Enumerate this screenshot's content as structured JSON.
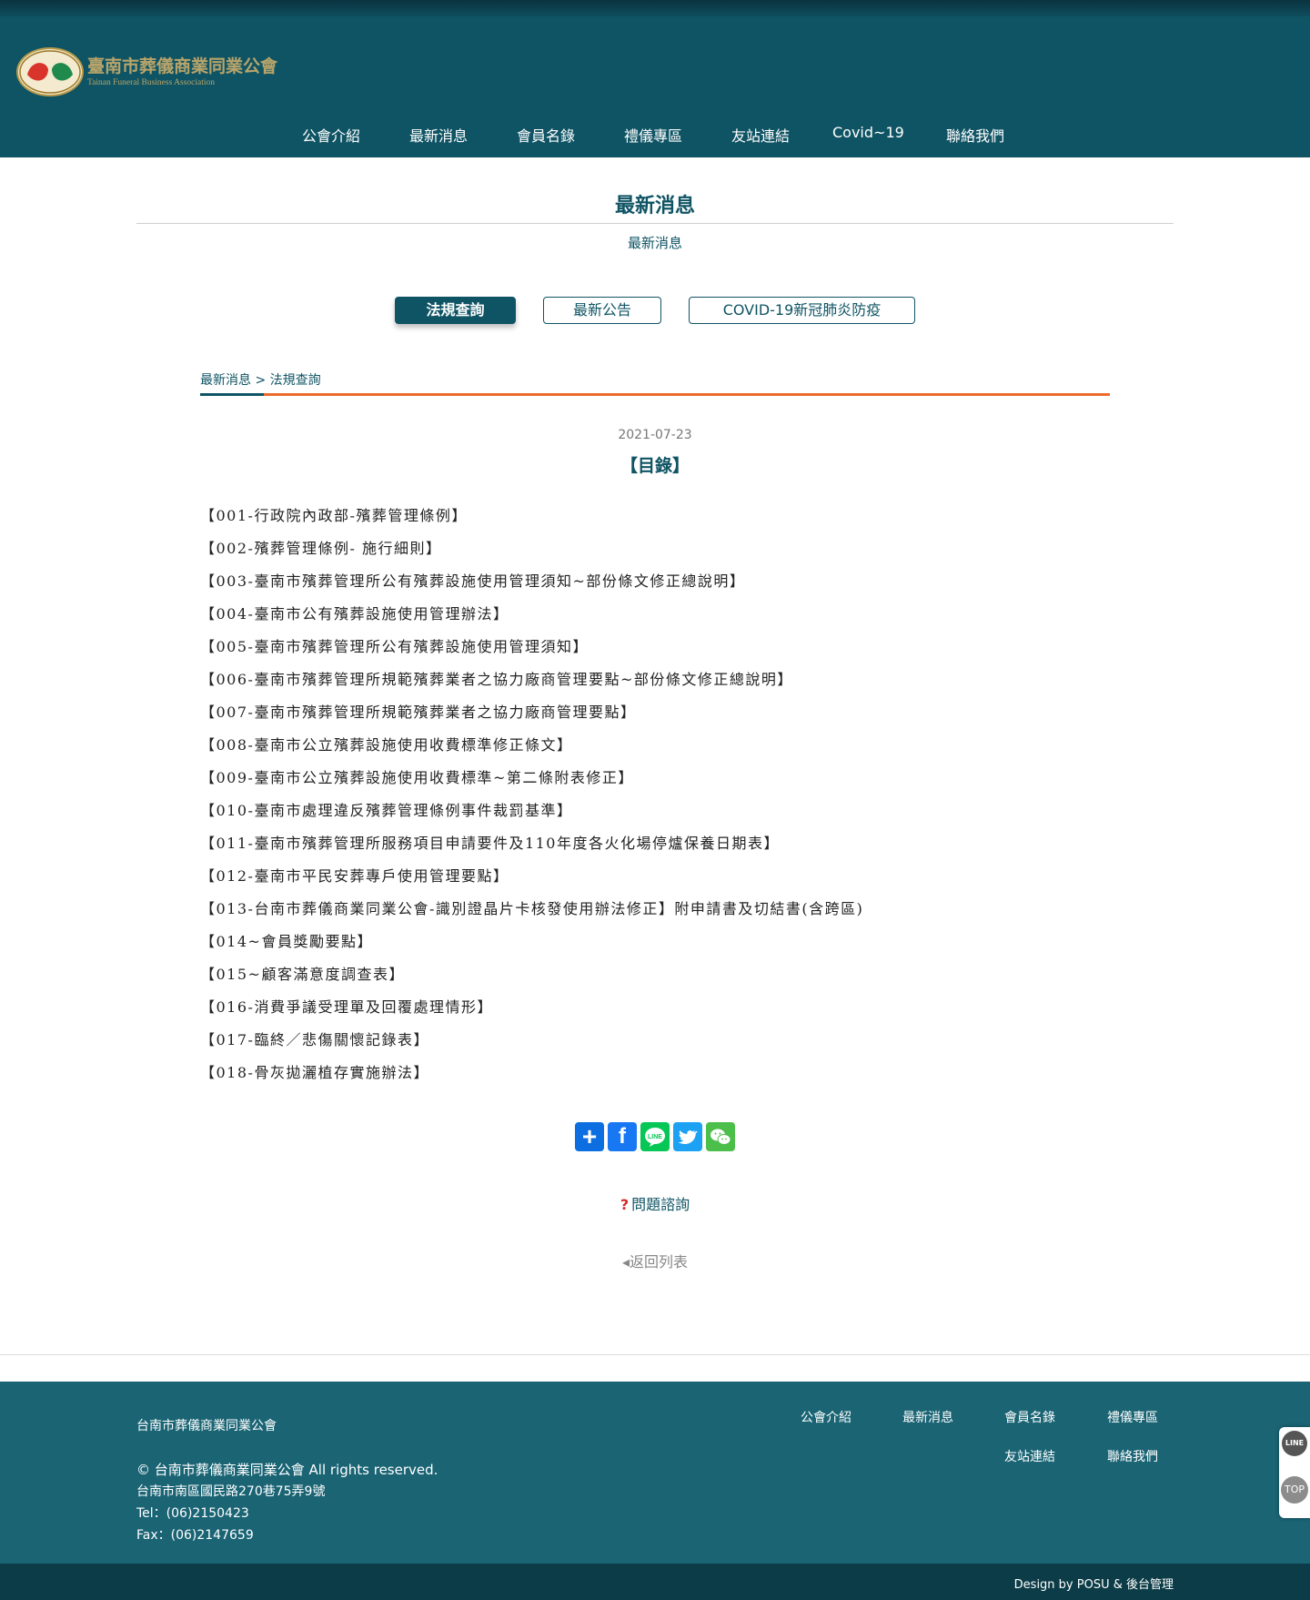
{
  "site": {
    "logo_name": "臺南市葬儀商業同業公會",
    "logo_english": "Tainan Funeral Business Association",
    "logo_seal_text": "臺南市葬儀商業同業公會"
  },
  "nav": {
    "items": [
      {
        "label": "公會介紹"
      },
      {
        "label": "最新消息"
      },
      {
        "label": "會員名錄"
      },
      {
        "label": "禮儀專區"
      },
      {
        "label": "友站連結"
      },
      {
        "label": "Covid~19"
      },
      {
        "label": "聯絡我們"
      }
    ]
  },
  "page": {
    "title": "最新消息",
    "subtitle": "最新消息"
  },
  "tabs": [
    {
      "label": "法規查詢",
      "active": true
    },
    {
      "label": "最新公告",
      "active": false
    },
    {
      "label": "COVID-19新冠肺炎防疫",
      "active": false
    }
  ],
  "breadcrumb": {
    "text": "最新消息 > 法規查詢"
  },
  "article": {
    "date": "2021-07-23",
    "title": "【目錄】",
    "items": [
      "【001-行政院內政部-殯葬管理條例】",
      "【002-殯葬管理條例- 施行細則】",
      "【003-臺南市殯葬管理所公有殯葬設施使用管理須知~部份條文修正總說明】",
      "【004-臺南市公有殯葬設施使用管理辦法】",
      "【005-臺南市殯葬管理所公有殯葬設施使用管理須知】",
      "【006-臺南市殯葬管理所規範殯葬業者之協力廠商管理要點~部份條文修正總說明】",
      "【007-臺南市殯葬管理所規範殯葬業者之協力廠商管理要點】",
      "【008-臺南市公立殯葬設施使用收費標準修正條文】",
      "【009-臺南市公立殯葬設施使用收費標準~第二條附表修正】",
      "【010-臺南市處理違反殯葬管理條例事件裁罰基準】",
      "【011-臺南市殯葬管理所服務項目申請要件及110年度各火化場停爐保養日期表】",
      "【012-臺南市平民安葬專戶使用管理要點】",
      "【013-台南市葬儀商業同業公會-識別證晶片卡核發使用辦法修正】附申請書及切結書(含跨區)",
      "【014~會員獎勵要點】",
      "【015~顧客滿意度調查表】",
      "【016-消費爭議受理單及回覆處理情形】",
      "【017-臨終／悲傷關懷記錄表】",
      "【018-骨灰拋灑植存實施辦法】"
    ]
  },
  "share": {
    "add_icon": "+",
    "facebook_icon": "f",
    "line_icon": "LINE",
    "twitter_icon": "twitter-bird",
    "wechat_icon": "wechat-bubbles"
  },
  "links": {
    "faq": "問題諮詢",
    "faq_icon": "?",
    "back": "◂返回列表"
  },
  "footer": {
    "org": "台南市葬儀商業同業公會",
    "copyright": "© 台南市葬儀商業同業公會 All rights reserved.",
    "address": "台南市南區國民路270巷75弄9號",
    "tel": "Tel：(06)2150423",
    "fax": "Fax：(06)2147659",
    "links": [
      {
        "label": "公會介紹"
      },
      {
        "label": "最新消息"
      },
      {
        "label": "會員名錄"
      },
      {
        "label": "禮儀專區"
      },
      {
        "label": "友站連結"
      },
      {
        "label": "聯絡我們"
      }
    ],
    "credit": "Design by POSU & 後台管理"
  },
  "float": {
    "line": "LINE",
    "top": "TOP"
  },
  "colors": {
    "primary": "#0f5464",
    "accent": "#ec6a2c",
    "footer": "#1a6474",
    "footer_bottom": "#0c3c47"
  }
}
